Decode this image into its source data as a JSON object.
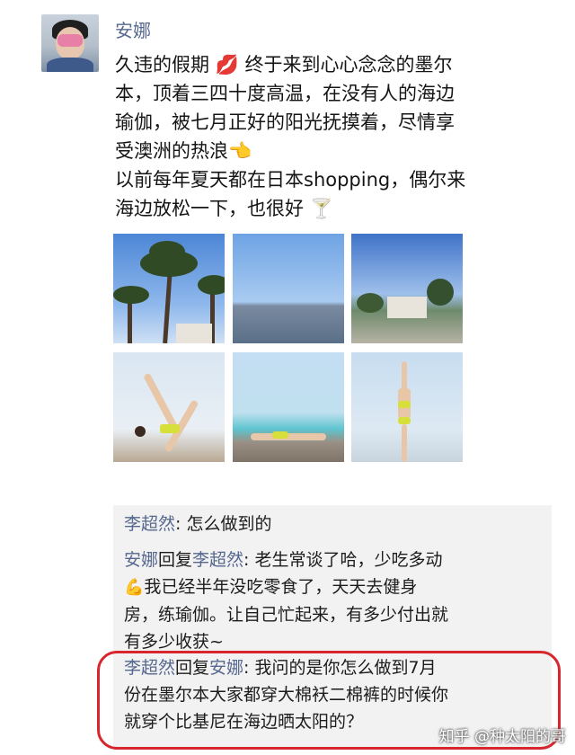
{
  "post": {
    "author": "安娜",
    "text_lines": [
      "久违的假期 💋 终于来到心心念念的墨尔",
      "本，顶着三四十度高温，在没有人的海边",
      "瑜伽，被七月正好的阳光抚摸着，尽情享",
      "受澳洲的热浪👈",
      "以前每年夏天都在日本shopping，偶尔来",
      "海边放松一下，也很好 🍸"
    ],
    "photos": [
      "palm-trees-photo",
      "sea-horizon-photo",
      "beach-house-photo",
      "yoga-pose-1-photo",
      "yoga-pier-photo",
      "yoga-tree-pose-photo"
    ]
  },
  "comments": {
    "c1": {
      "name": "李超然",
      "text": ": 怎么做到的"
    },
    "c2": {
      "name": "安娜",
      "reply_word": "回复",
      "reply_to": "李超然",
      "line1": ": 老生常谈了哈，少吃多动",
      "line2": "我已经半年没吃零食了，天天去健身",
      "line3": "房，练瑜伽。让自己忙起来，有多少付出就",
      "line4": "有多少收获~"
    },
    "c3": {
      "name": "李超然",
      "reply_word": "回复",
      "reply_to": "安娜",
      "line1": ": 我问的是你怎么做到7月",
      "line2": "份在墨尔本大家都穿大棉袄二棉裤的时候你",
      "line3": "就穿个比基尼在海边晒太阳的？"
    }
  },
  "watermark": "知乎 @种太阳的哥",
  "colors": {
    "name_blue": "#56688f",
    "highlight_red": "#d8262e",
    "comment_bg": "#f2f2f2"
  }
}
